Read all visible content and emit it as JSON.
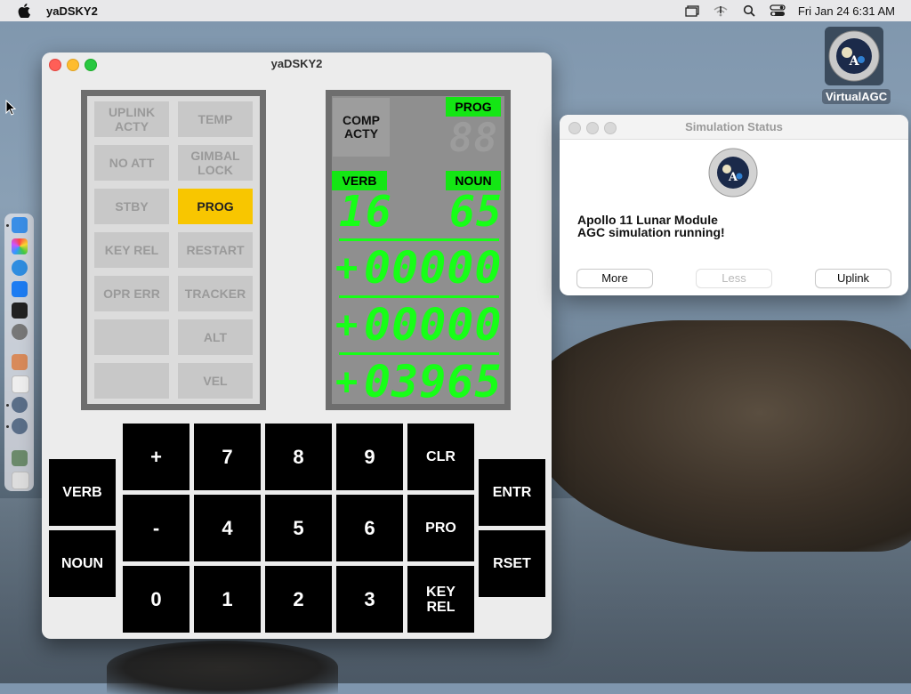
{
  "menubar": {
    "app_name": "yaDSKY2",
    "datetime": "Fri Jan 24  6:31 AM"
  },
  "desktop_icon": {
    "label": "VirtualAGC"
  },
  "dsky_window": {
    "title": "yaDSKY2",
    "indicator_lamps": [
      {
        "label": "UPLINK\nACTY",
        "on": false
      },
      {
        "label": "TEMP",
        "on": false
      },
      {
        "label": "NO ATT",
        "on": false
      },
      {
        "label": "GIMBAL\nLOCK",
        "on": false
      },
      {
        "label": "STBY",
        "on": false
      },
      {
        "label": "PROG",
        "on": true
      },
      {
        "label": "KEY REL",
        "on": false
      },
      {
        "label": "RESTART",
        "on": false
      },
      {
        "label": "OPR ERR",
        "on": false
      },
      {
        "label": "TRACKER",
        "on": false
      },
      {
        "label": "",
        "on": false
      },
      {
        "label": "ALT",
        "on": false
      },
      {
        "label": "",
        "on": false
      },
      {
        "label": "VEL",
        "on": false
      }
    ],
    "display": {
      "comp_acty": "COMP\nACTY",
      "prog_label": "PROG",
      "prog_value": "88",
      "verb_label": "VERB",
      "noun_label": "NOUN",
      "verb_value": "16",
      "noun_value": "65",
      "r1_sign": "+",
      "r1_value": "00000",
      "r2_sign": "+",
      "r2_value": "00000",
      "r3_sign": "+",
      "r3_value": "03965"
    },
    "keys": {
      "verb": "VERB",
      "noun": "NOUN",
      "plus": "+",
      "minus": "-",
      "zero": "0",
      "seven": "7",
      "eight": "8",
      "nine": "9",
      "four": "4",
      "five": "5",
      "six": "6",
      "one": "1",
      "two": "2",
      "three": "3",
      "clr": "CLR",
      "pro": "PRO",
      "key_rel": "KEY\nREL",
      "entr": "ENTR",
      "rset": "RSET"
    }
  },
  "status_window": {
    "title": "Simulation Status",
    "message": "Apollo 11 Lunar Module\nAGC simulation running!",
    "buttons": {
      "more": "More",
      "less": "Less",
      "uplink": "Uplink"
    }
  },
  "colors": {
    "lamp_on": "#f8c600",
    "display_green": "#17ff17"
  }
}
